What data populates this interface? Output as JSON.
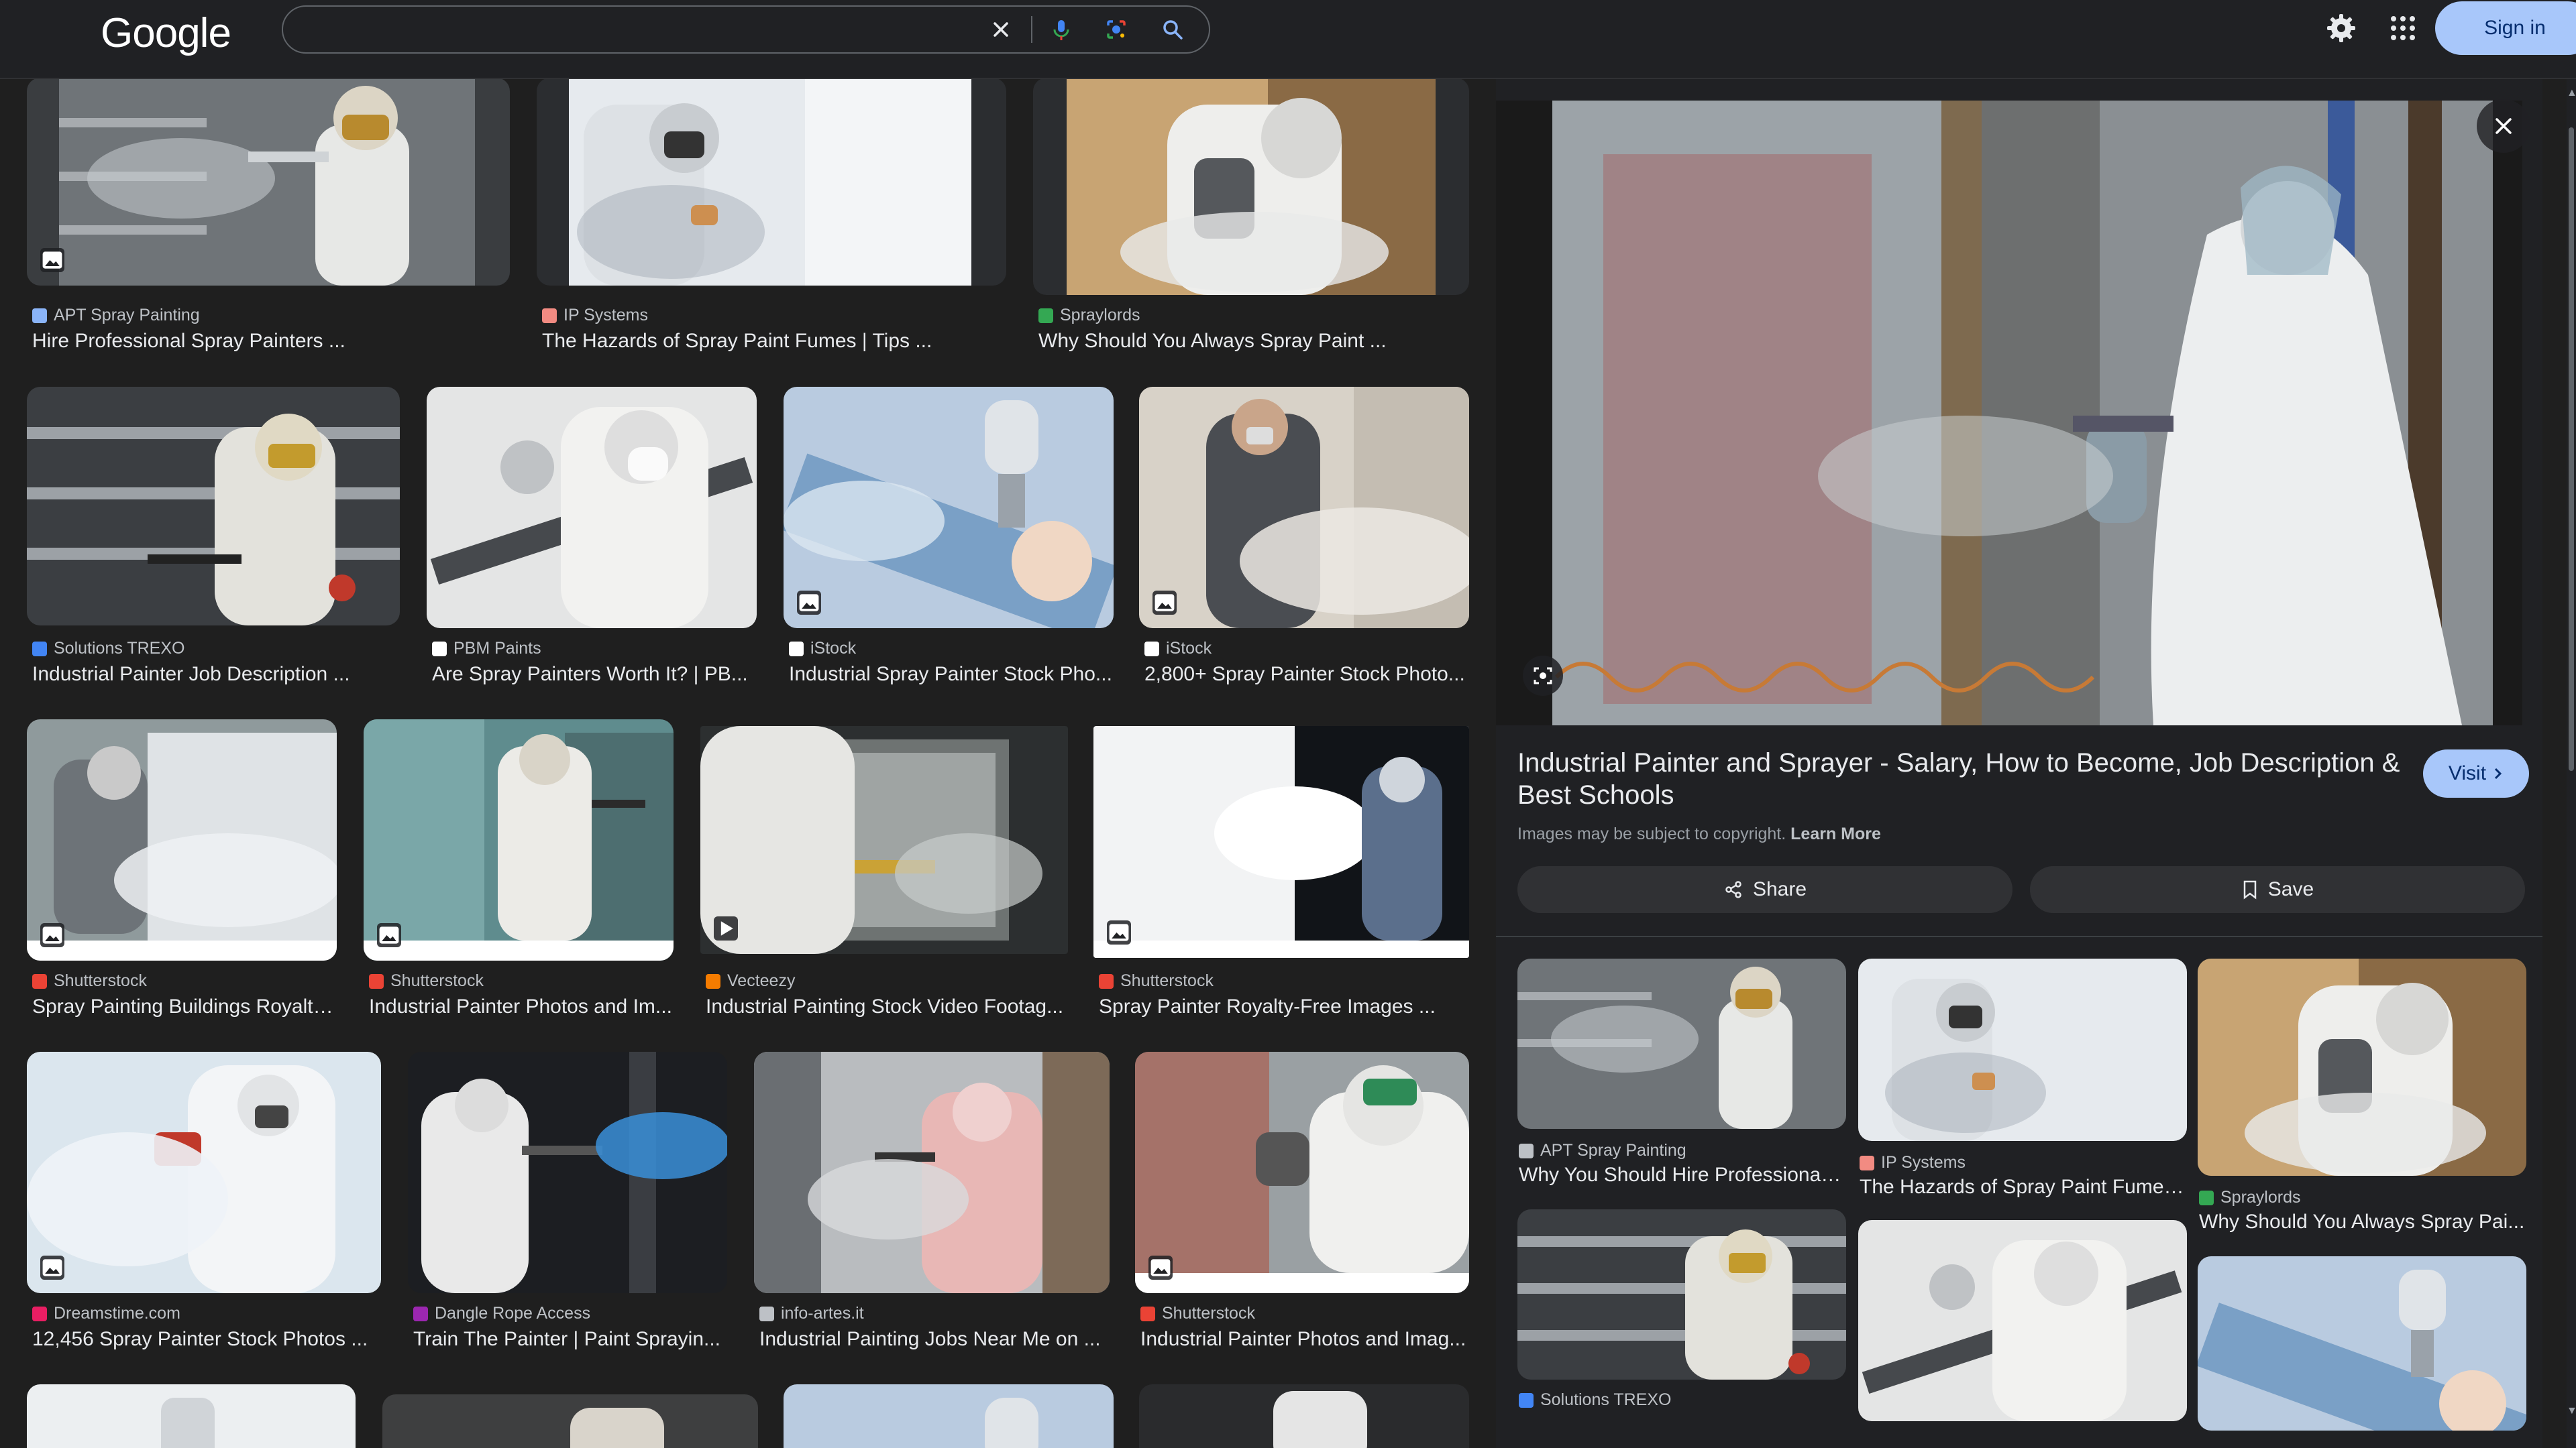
{
  "header": {
    "logo": "Google",
    "search": {
      "value": "",
      "placeholder": ""
    },
    "signin_label": "Sign in"
  },
  "icons": {
    "clear": "close-icon",
    "voice": "mic-icon",
    "lens": "camera-lens-icon",
    "search": "search-icon",
    "settings": "gear-icon",
    "apps": "grid-icon"
  },
  "results": [
    {
      "source": "APT Spray Painting",
      "title": "Hire Professional Spray Painters ...",
      "badge": "image",
      "fav": "#8ab4f8"
    },
    {
      "source": "IP Systems",
      "title": "The Hazards of Spray Paint Fumes | Tips ...",
      "badge": "",
      "fav": "#f28b82"
    },
    {
      "source": "Spraylords",
      "title": "Why Should You Always Spray Paint ...",
      "badge": "",
      "fav": "#34a853"
    },
    {
      "source": "Solutions TREXO",
      "title": "Industrial Painter Job Description ...",
      "badge": "",
      "fav": "#4285f4"
    },
    {
      "source": "PBM Paints",
      "title": "Are Spray Painters Worth It? | PB...",
      "badge": "",
      "fav": "#ffffff"
    },
    {
      "source": "iStock",
      "title": "Industrial Spray Painter Stock Pho...",
      "badge": "image",
      "fav": "#ffffff"
    },
    {
      "source": "iStock",
      "title": "2,800+ Spray Painter Stock Photo...",
      "badge": "image",
      "fav": "#ffffff"
    },
    {
      "source": "Shutterstock",
      "title": "Spray Painting Buildings Royalty...",
      "badge": "image",
      "fav": "#ea4335"
    },
    {
      "source": "Shutterstock",
      "title": "Industrial Painter Photos and Im...",
      "badge": "image",
      "fav": "#ea4335"
    },
    {
      "source": "Vecteezy",
      "title": "Industrial Painting Stock Video Footag...",
      "badge": "video",
      "fav": "#f57c00"
    },
    {
      "source": "Shutterstock",
      "title": "Spray Painter Royalty-Free Images ...",
      "badge": "image",
      "fav": "#ea4335"
    },
    {
      "source": "Dreamstime.com",
      "title": "12,456 Spray Painter Stock Photos ...",
      "badge": "image",
      "fav": "#e91e63"
    },
    {
      "source": "Dangle Rope Access",
      "title": "Train The Painter | Paint Sprayin...",
      "badge": "",
      "fav": "#9c27b0"
    },
    {
      "source": "info-artes.it",
      "title": "Industrial Painting Jobs Near Me on ...",
      "badge": "",
      "fav": "#bdc1c6"
    },
    {
      "source": "Shutterstock",
      "title": "Industrial Painter Photos and Imag...",
      "badge": "image",
      "fav": "#ea4335"
    }
  ],
  "preview": {
    "title": "Industrial Painter and Sprayer - Salary, How to Become, Job Description & Best Schools",
    "visit_label": "Visit",
    "copyright": "Images may be subject to copyright.",
    "learn_more": "Learn More",
    "share_label": "Share",
    "save_label": "Save",
    "related": [
      {
        "source": "APT Spray Painting",
        "title": "Why You Should Hire Professional ..."
      },
      {
        "source": "IP Systems",
        "title": "The Hazards of Spray Paint Fumes ..."
      },
      {
        "source": "Spraylords",
        "title": "Why Should You Always Spray Pai..."
      },
      {
        "source": "Solutions TREXO",
        "title": ""
      }
    ]
  }
}
